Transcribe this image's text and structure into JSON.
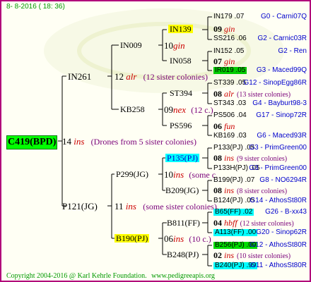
{
  "header": {
    "date": "8- 8-2016 ( 18: 36)"
  },
  "footer": {
    "copyright": "Copyright 2004-2016 @ Karl Kehrle Foundation.",
    "url": "www.pedigreeapis.org"
  },
  "root": {
    "label": "C419(BPD)",
    "year": "14",
    "mark": "ins",
    "note": "(Drones from 5 sister colonies)"
  },
  "queens": {
    "q1": {
      "name": "IN261"
    },
    "q2": {
      "name": "P121(JG)"
    },
    "q11": {
      "year": "12",
      "mark": "alr",
      "note": "(12 sister colonies)"
    },
    "q12": {
      "year": "11",
      "mark": "ins",
      "note": "(some sister colonies)"
    },
    "q111": {
      "name": "IN009"
    },
    "q112": {
      "name": "KB258"
    },
    "q121": {
      "name": "P299(JG)"
    },
    "q122": {
      "name": "B190(PJ)"
    },
    "q111x": {
      "year": "10",
      "mark": "gin"
    },
    "q112x": {
      "year": "09",
      "mark": "nex",
      "note": "(12 c.)"
    },
    "q121x": {
      "year": "10",
      "mark": "ins",
      "note": "(some c."
    },
    "q122x": {
      "year": "06",
      "mark": "ins",
      "note": "(10 c.)"
    },
    "g3": {
      "a": "IN139",
      "b": "IN058",
      "c": "ST394",
      "d": "PS596",
      "e": "P135(PJ)",
      "f": "B209(JG)",
      "g": "B811(FF)",
      "h": "B248(PJ)"
    }
  },
  "rows": [
    {
      "name": "IN179",
      "yr": ".07",
      "tag": "G0 - Carni07Q"
    },
    {
      "year": "09",
      "mark": "gin"
    },
    {
      "name": "SS216",
      "yr": ".06",
      "tag": "G2 - Carnic03R"
    },
    {
      "name": "IN152",
      "yr": ".05",
      "tag": "G2 - Ren"
    },
    {
      "year": "07",
      "mark": "gin"
    },
    {
      "name": "IR019",
      "yr": ".05",
      "tag": "G3 - Maced99Q"
    },
    {
      "name": "ST339",
      "yr": ".05",
      "tag": "G12 - SinopEgg86R"
    },
    {
      "year": "08",
      "mark": "alr",
      "note": "(13 sister colonies)"
    },
    {
      "name": "ST343",
      "yr": ".03",
      "tag": "G4 - Bayburt98-3"
    },
    {
      "name": "PS506",
      "yr": ".04",
      "tag": "G17 - Sinop72R"
    },
    {
      "year": "06",
      "mark": "fun"
    },
    {
      "name": "KB169",
      "yr": ".03",
      "tag": "G6 - Maced93R"
    },
    {
      "name": "P133(PJ)",
      "yr": ".05",
      "tag": "G3 - PrimGreen00"
    },
    {
      "year": "08",
      "mark": "ins",
      "note": "(9 sister colonies)"
    },
    {
      "name": "P133H(PJ)",
      "yr": ".05",
      "tag": "G3 - PrimGreen00"
    },
    {
      "name": "B199(PJ)",
      "yr": ".07",
      "tag": "G8 - NO6294R"
    },
    {
      "year": "08",
      "mark": "ins",
      "note": "(8 sister colonies)"
    },
    {
      "name": "B124(PJ)",
      "yr": ".05",
      "tag": "G14 - AthosSt80R"
    },
    {
      "name": "B65(FF)",
      "yr": ".02",
      "tag": "G26 - B-xx43"
    },
    {
      "year": "04",
      "mark": "hbff",
      "note": "(12 sister colonies)"
    },
    {
      "name": "A113(FF)",
      "yr": ".00",
      "tag": "G20 - Sinop62R"
    },
    {
      "name": "B256(PJ)",
      "yr": ".00",
      "tag": "G12 - AthosSt80R"
    },
    {
      "year": "02",
      "mark": "ins",
      "note": "(10 sister colonies)"
    },
    {
      "name": "B240(PJ)",
      "yr": ".99",
      "tag": "G11 - AthosSt80R"
    }
  ]
}
